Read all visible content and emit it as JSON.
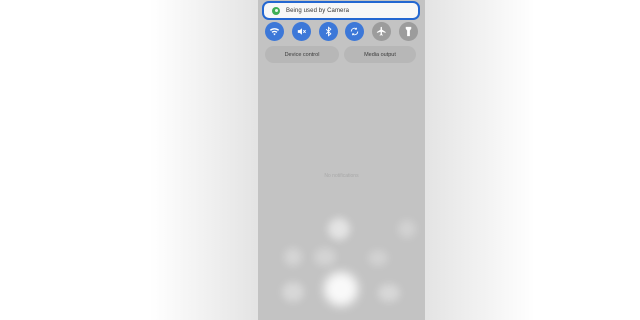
{
  "privacy_chip": {
    "text": "Being used by Camera",
    "indicator_color": "#3fae55"
  },
  "quick_settings": [
    {
      "name": "wifi",
      "icon": "wifi-icon",
      "state": "on"
    },
    {
      "name": "sound",
      "icon": "mute-icon",
      "state": "on"
    },
    {
      "name": "bluetooth",
      "icon": "bluetooth-icon",
      "state": "on"
    },
    {
      "name": "auto-rotate",
      "icon": "auto-rotate-icon",
      "state": "on"
    },
    {
      "name": "airplane-mode",
      "icon": "airplane-icon",
      "state": "off"
    },
    {
      "name": "flashlight",
      "icon": "flashlight-icon",
      "state": "off"
    }
  ],
  "buttons": {
    "device_control": "Device control",
    "media_output": "Media output"
  },
  "notifications": {
    "empty_text": "No notifications"
  },
  "colors": {
    "accent": "#3d78d8",
    "highlight_border": "#2367d1",
    "panel": "#c3c3c3"
  }
}
